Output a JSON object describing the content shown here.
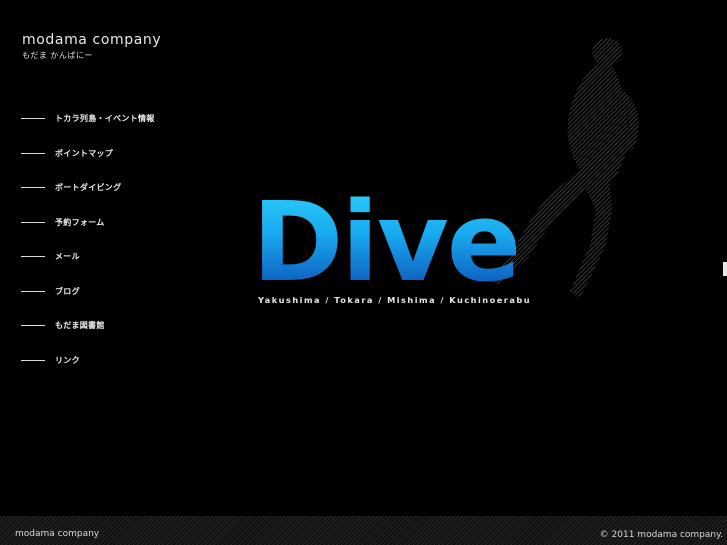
{
  "brand": {
    "title": "modama  company",
    "subtitle": "もだま かんぱにー"
  },
  "nav": {
    "items": [
      {
        "label": "トカラ列島・イベント情報"
      },
      {
        "label": "ポイントマップ"
      },
      {
        "label": "ボートダイビング"
      },
      {
        "label": "予約フォーム"
      },
      {
        "label": "メール"
      },
      {
        "label": "ブログ"
      },
      {
        "label": "もだま図書館"
      },
      {
        "label": "リンク"
      }
    ]
  },
  "hero": {
    "word": "Dive",
    "tagline": "Yakushima / Tokara / Mishima / Kuchinoerabu"
  },
  "footer": {
    "left": "modama company",
    "right": "© 2011 modama company."
  },
  "colors": {
    "background": "#000000",
    "accent_top": "#2fd0ff",
    "accent_bottom": "#0a3ea8",
    "text": "#f0f0f0"
  }
}
